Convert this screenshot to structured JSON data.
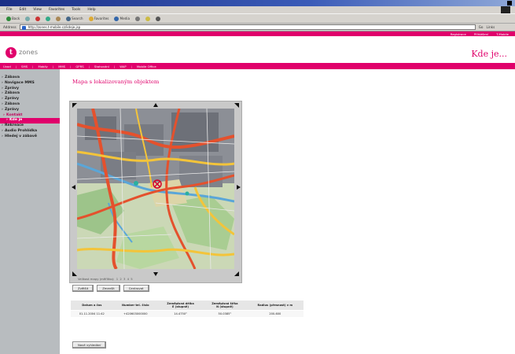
{
  "browser": {
    "menu": [
      "File",
      "Edit",
      "View",
      "Favorites",
      "Tools",
      "Help"
    ],
    "toolbar": [
      "Back",
      "",
      "",
      "",
      "",
      "Search",
      "Favorites",
      "Media",
      "",
      "",
      "",
      ""
    ],
    "address_label": "Address",
    "url": "http://zones.t-mobile.cz/kdeje.jsp",
    "go": "Go",
    "links": "Links"
  },
  "site": {
    "top_links": [
      "Registrace",
      "Přihlášení",
      "T-Mobile"
    ],
    "logo_letter": "t",
    "logo_text": "zones",
    "header_title": "Kde je...",
    "nav": [
      "Úvod",
      "SMS",
      "Mobily",
      "MMS",
      "GPRS",
      "Stahování",
      "WAP",
      "Mobile Office"
    ]
  },
  "sidebar": {
    "items": [
      {
        "label": "Zábava",
        "type": "normal"
      },
      {
        "label": "Navigace MMS",
        "type": "normal"
      },
      {
        "label": "Zprávy",
        "type": "normal"
      },
      {
        "label": "Zábava",
        "type": "normal"
      },
      {
        "label": "Zprávy",
        "type": "normal"
      },
      {
        "label": "Zábava",
        "type": "normal"
      },
      {
        "label": "Zprávy",
        "type": "normal"
      },
      {
        "label": "Kontakt",
        "type": "sub"
      },
      {
        "label": "Kde je",
        "type": "active"
      },
      {
        "label": "Rekreace",
        "type": "normal"
      },
      {
        "label": "Audio Prohlídka",
        "type": "normal"
      },
      {
        "label": "Hledej v zábavě",
        "type": "normal"
      }
    ]
  },
  "main": {
    "title": "Mapa s lokalizovaným objektem",
    "zoom_label": "Velikost mapy (měřítko):",
    "zoom_levels": [
      "1",
      "2",
      "3",
      "4",
      "5"
    ],
    "buttons": [
      "Zvětšit",
      "Zmenšit",
      "Centrovat"
    ],
    "table": {
      "headers": [
        "Datum a čas",
        "Number tel. číslo",
        "Zeměpisná délka",
        "Zeměpisná šířka",
        "Radius (přesnost) v m"
      ],
      "subheaders": [
        "",
        "",
        "E (stupně)",
        "N (stupně)",
        ""
      ],
      "rows": [
        [
          "01.11.2004 11:42",
          "+420603000000",
          "14.4750°",
          "50.0385°",
          "200-600"
        ]
      ]
    },
    "new_search": "Nové vyhledání"
  },
  "colors": {
    "brand": "#e0006b",
    "sidebar": "#b8bcbf"
  }
}
